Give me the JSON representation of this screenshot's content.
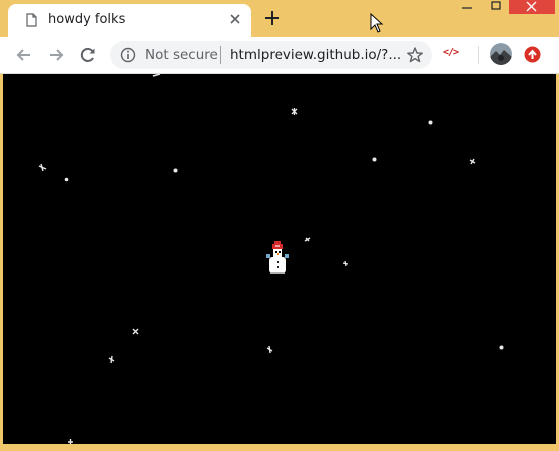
{
  "browser": {
    "tab": {
      "title": "howdy folks",
      "icon": "document-icon"
    },
    "omnibox": {
      "security_label": "Not secure",
      "url": "htmlpreview.github.io/?..."
    },
    "extension_label": "</>",
    "colors": {
      "frame": "#f0c66b",
      "close": "#e0463b",
      "ext_red": "#c5221f"
    }
  },
  "page": {
    "background": "#000000",
    "content": "animated snowflakes falling around a snowman sprite"
  }
}
